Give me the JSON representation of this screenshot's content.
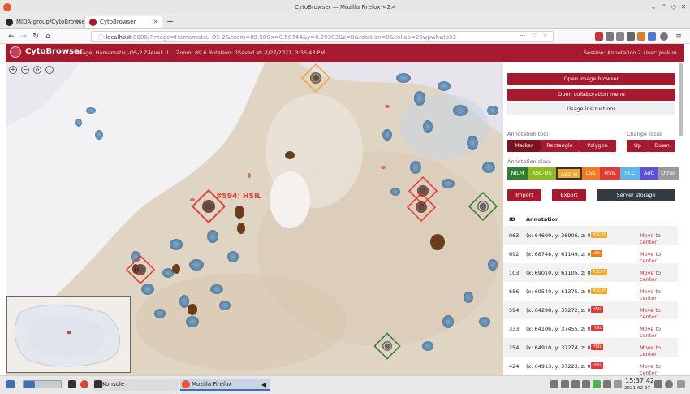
{
  "window": {
    "title": "CytoBrowser — Mozilla Firefox <2>"
  },
  "tabs": [
    {
      "label": "MIDA-group/CytoBrowser",
      "favicon_color": "#24292e"
    },
    {
      "label": "CytoBrowser",
      "favicon_color": "#a6192e"
    }
  ],
  "nav": {
    "url_host": "localhost",
    "url_rest": ":8080/?image=Hamamatsu-OS-2&zoom=89.58&x=0.50744&y=0.29383&z=0&rotation=0&collab=26wpwhwlp92"
  },
  "header": {
    "brand": "CytoBrowser",
    "image": "Image: Hamamatsu-OS-2",
    "zlevel": "Z-level: 0",
    "zoom": "Zoom: 89.6",
    "rotation": "Rotation: 0°",
    "saved": "Saved at: 2/27/2021, 3:36:43 PM",
    "session": "Session: Annotation 2",
    "user": "User: Joakim"
  },
  "viewer": {
    "zoom_controls": [
      "+",
      "−",
      "⌂",
      "⛶"
    ],
    "hover_label": "#594: HSIL"
  },
  "panel": {
    "open_browser": "Open image browser",
    "collab_menu": "Open collaboration menu",
    "usage": "Usage instructions",
    "tool_label": "Annotation tool",
    "tools": [
      "Marker",
      "Rectangle",
      "Polygon"
    ],
    "focus_label": "Change focus",
    "focus": [
      "Up",
      "Down"
    ],
    "class_label": "Annotation class",
    "classes": [
      {
        "name": "NILM",
        "color": "#2e7d32"
      },
      {
        "name": "ASC-US",
        "color": "#8bbd23"
      },
      {
        "name": "ASC-H",
        "color": "#f0a92e"
      },
      {
        "name": "LSIL",
        "color": "#f07b1f"
      },
      {
        "name": "HSIL",
        "color": "#e53935"
      },
      {
        "name": "SCC",
        "color": "#5bb7e6"
      },
      {
        "name": "AdC",
        "color": "#5b52d6"
      },
      {
        "name": "Other",
        "color": "#9a9a9a"
      }
    ],
    "import": "Import",
    "export": "Export",
    "server": "Server storage",
    "col_id": "ID",
    "col_annotation": "Annotation",
    "rows": [
      {
        "id": "963",
        "coord": "(x: 64609, y: 36906, z: 0)",
        "cls": "ASC-H",
        "color": "#f0a92e",
        "action": "Move to center"
      },
      {
        "id": "692",
        "coord": "(x: 68748, y: 61149, z: 0)",
        "cls": "LSIL",
        "color": "#f07b1f",
        "action": "Move to center"
      },
      {
        "id": "103",
        "coord": "(x: 69010, y: 61105, z: 0)",
        "cls": "ASC-H",
        "color": "#f0a92e",
        "action": "Move to center"
      },
      {
        "id": "656",
        "coord": "(x: 69540, y: 61375, z: 0)",
        "cls": "ASC-H",
        "color": "#f0a92e",
        "action": "Move to center"
      },
      {
        "id": "594",
        "coord": "(x: 64298, y: 37272, z: 0)",
        "cls": "HSIL",
        "color": "#e53935",
        "action": "Move to center"
      },
      {
        "id": "333",
        "coord": "(x: 64106, y: 37455, z: 0)",
        "cls": "HSIL",
        "color": "#e53935",
        "action": "Move to center"
      },
      {
        "id": "254",
        "coord": "(x: 64910, y: 37274, z: 0)",
        "cls": "HSIL",
        "color": "#e53935",
        "action": "Move to center"
      },
      {
        "id": "424",
        "coord": "(x: 64913, y: 37223, z: 0)",
        "cls": "HSIL",
        "color": "#e53935",
        "action": "Move to center"
      }
    ]
  },
  "taskbar": {
    "konsole": "Konsole",
    "firefox": "Mozilla Firefox",
    "time": "15:37:42",
    "date": "2021-02-27"
  }
}
